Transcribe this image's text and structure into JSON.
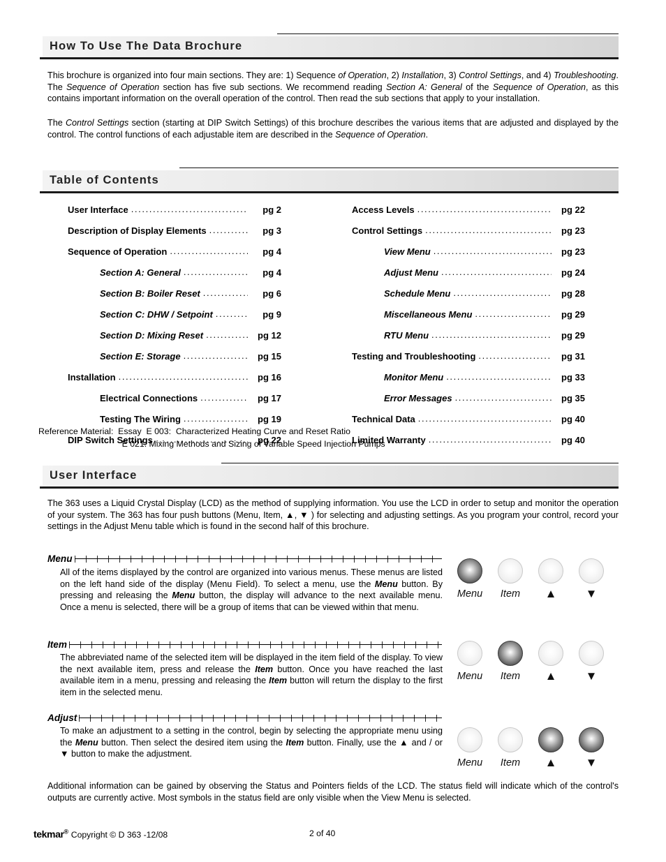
{
  "sections": {
    "how_to_use": {
      "title": "How To Use The Data Brochure",
      "p1_html": "This brochure is organized into four main sections. They are: 1) Sequence <i>of Operation</i>, 2) <i>Installation</i>, 3) <i>Control Settings</i>, and 4) <i>Troubleshooting</i>. The <i>Sequence of Operation</i> section has five sub sections. We recommend reading <i>Section A: General</i> of the <i>Sequence of Operation</i>, as this contains important information on the overall operation of the control. Then read the sub sections that apply to your installation.",
      "p2_html": "The <i>Control Settings</i> section (starting at DIP Switch Settings) of this brochure describes the various items that are adjusted and displayed by the control. The control functions of each adjustable item are described in the <i>Sequence of Operation</i>."
    },
    "table_of_contents": {
      "title": "Table of Contents",
      "left_entries": [
        {
          "label": "User Interface",
          "page": "pg 2",
          "level": 1,
          "italic": false
        },
        {
          "label": "Description of Display Elements",
          "page": "pg 3",
          "level": 1,
          "italic": false
        },
        {
          "label": "Sequence of Operation",
          "page": "pg 4",
          "level": 1,
          "italic": false
        },
        {
          "label": "Section A: General",
          "page": "pg 4",
          "level": 2,
          "italic": true
        },
        {
          "label": "Section B: Boiler Reset",
          "page": "pg 6",
          "level": 2,
          "italic": true
        },
        {
          "label": "Section C: DHW /  Setpoint",
          "page": "pg 9",
          "level": 2,
          "italic": true
        },
        {
          "label": "Section D: Mixing Reset",
          "page": "pg 12",
          "level": 2,
          "italic": true
        },
        {
          "label": "Section E: Storage",
          "page": "pg 15",
          "level": 2,
          "italic": true
        },
        {
          "label": "Installation",
          "page": "pg 16",
          "level": 1,
          "italic": false
        },
        {
          "label": "Electrical Connections",
          "page": "pg 17",
          "level": 2,
          "italic": false
        },
        {
          "label": "Testing The Wiring",
          "page": "pg 19",
          "level": 2,
          "italic": false
        },
        {
          "label": "DIP Switch Settings",
          "page": "pg 22",
          "level": 1,
          "italic": false
        }
      ],
      "right_entries": [
        {
          "label": "Access Levels",
          "page": "pg 22",
          "level": 1,
          "italic": false
        },
        {
          "label": "Control Settings",
          "page": "pg 23",
          "level": 1,
          "italic": false
        },
        {
          "label": "View Menu",
          "page": "pg 23",
          "level": 2,
          "italic": true
        },
        {
          "label": "Adjust Menu",
          "page": "pg 24",
          "level": 2,
          "italic": true
        },
        {
          "label": "Schedule Menu",
          "page": "pg 28",
          "level": 2,
          "italic": true
        },
        {
          "label": "Miscellaneous Menu",
          "page": "pg 29",
          "level": 2,
          "italic": true
        },
        {
          "label": "RTU Menu",
          "page": "pg 29",
          "level": 2,
          "italic": true
        },
        {
          "label": "Testing and Troubleshooting",
          "page": "pg 31",
          "level": 1,
          "italic": false
        },
        {
          "label": "Monitor Menu",
          "page": "pg 33",
          "level": 2,
          "italic": true
        },
        {
          "label": "Error Messages",
          "page": "pg 35",
          "level": 2,
          "italic": true
        },
        {
          "label": "Technical Data",
          "page": "pg 40",
          "level": 1,
          "italic": false
        },
        {
          "label": "Limited Warranty",
          "page": "pg 40",
          "level": 1,
          "italic": false
        }
      ],
      "reference_line1": "Reference Material:  Essay  E 003:  Characterized Heating Curve and Reset Ratio",
      "reference_line2": "                                   E 021: Mixing Methods and Sizing of Variable Speed Injection Pumps"
    },
    "user_interface": {
      "title": "User Interface",
      "intro_html": "The 363 uses a Liquid Crystal Display (LCD) as the method of supplying information. You use the LCD in order to setup and monitor the operation of your system. The 363 has four push buttons (Menu, Item, &#9650;, &#9660; ) for selecting and adjusting settings. As you program your control, record your settings in the Adjust Menu table which is found in the second half of this brochure.",
      "subsections": [
        {
          "name": "Menu",
          "body_html": "All of the items displayed by the control are organized into various menus. These menus are listed on the left hand side of the display (Menu Field). To select a menu, use the <b><i>Menu</i></b> button. By pressing and releasing the <b><i>Menu</i></b> button, the display will advance to the next available menu. Once a menu is selected, there will be a group of items that can be viewed within that menu.",
          "buttons": [
            {
              "label": "Menu",
              "glyph": false,
              "active": true
            },
            {
              "label": "Item",
              "glyph": false,
              "active": false
            },
            {
              "label": "▲",
              "glyph": true,
              "active": false
            },
            {
              "label": "▼",
              "glyph": true,
              "active": false
            }
          ]
        },
        {
          "name": "Item",
          "body_html": "The abbreviated name of the selected item will be displayed in the item field of the display. To view the next available item, press and release the <b><i>Item</i></b> button. Once you have reached the last available item in a menu, pressing and releasing the <b><i>Item</i></b> button will return the display to the first item in the selected menu.",
          "buttons": [
            {
              "label": "Menu",
              "glyph": false,
              "active": false
            },
            {
              "label": "Item",
              "glyph": false,
              "active": true
            },
            {
              "label": "▲",
              "glyph": true,
              "active": false
            },
            {
              "label": "▼",
              "glyph": true,
              "active": false
            }
          ]
        },
        {
          "name": "Adjust",
          "body_html": "To make an adjustment to a setting in the control, begin by selecting the appropriate menu using the <b><i>Menu</i></b> button. Then select the desired item using the <b><i>Item</i></b> button. Finally, use the &#9650; and / or &#9660; button to make the adjustment.",
          "buttons": [
            {
              "label": "Menu",
              "glyph": false,
              "active": false
            },
            {
              "label": "Item",
              "glyph": false,
              "active": false
            },
            {
              "label": "▲",
              "glyph": true,
              "active": true
            },
            {
              "label": "▼",
              "glyph": true,
              "active": true
            }
          ]
        }
      ],
      "closing_html": "Additional information can be gained by observing the Status and Pointers fields of the LCD. The status field will indicate which of the control's outputs are currently active. Most symbols in the status field are only visible when the View Menu is selected."
    }
  },
  "footer": {
    "brand": "tekmar",
    "brand_mark": "®",
    "copyright": "Copyright © D 363 -12/08",
    "page_number": "2 of 40"
  },
  "leader_dots": "......................................................................................................................."
}
